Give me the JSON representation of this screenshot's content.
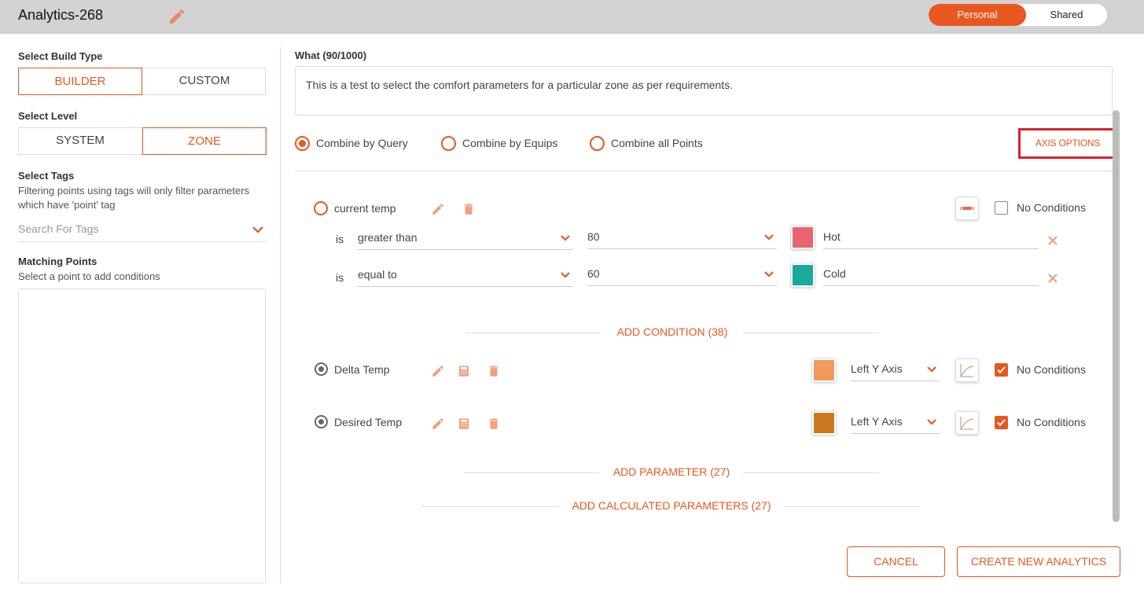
{
  "header": {
    "title": "Analytics-268",
    "toggle": {
      "personal": "Personal",
      "shared": "Shared",
      "selected": "Personal"
    }
  },
  "sidebar": {
    "build_type": {
      "label": "Select Build Type",
      "options": [
        "BUILDER",
        "CUSTOM"
      ],
      "selected": "BUILDER"
    },
    "level": {
      "label": "Select Level",
      "options": [
        "SYSTEM",
        "ZONE"
      ],
      "selected": "ZONE"
    },
    "tags": {
      "label": "Select Tags",
      "help_line1": "Filtering points using tags will only filter parameters",
      "help_line2": "which have 'point' tag",
      "placeholder": "Search For Tags"
    },
    "matching_points": {
      "label": "Matching Points",
      "help": "Select a point to add conditions"
    }
  },
  "main": {
    "what_label": "What (90/1000)",
    "what_text": "This is a test to select the comfort parameters for a particular zone as per requirements.",
    "combine_options": [
      {
        "label": "Combine by Query",
        "selected": true
      },
      {
        "label": "Combine by Equips",
        "selected": false
      },
      {
        "label": "Combine all Points",
        "selected": false
      }
    ],
    "axis_options": "AXIS OPTIONS",
    "params": [
      {
        "name": "current temp",
        "no_conditions_label": "No Conditions",
        "no_conditions_checked": false,
        "conditions": [
          {
            "is": "is",
            "operator": "greater than",
            "value": "80",
            "color": "#e8646f",
            "label": "Hot"
          },
          {
            "is": "is",
            "operator": "equal to",
            "value": "60",
            "color": "#1aaa9b",
            "label": "Cold"
          }
        ]
      },
      {
        "name": "Delta Temp",
        "color": "#f09a5b",
        "axis": "Left Y Axis",
        "no_conditions_label": "No Conditions",
        "no_conditions_checked": true
      },
      {
        "name": "Desired Temp",
        "color": "#c97a1e",
        "axis": "Left Y Axis",
        "no_conditions_label": "No Conditions",
        "no_conditions_checked": true
      }
    ],
    "add_condition": "ADD CONDITION (38)",
    "add_parameter": "ADD PARAMETER (27)",
    "add_calculated": "ADD CALCULATED PARAMETERS (27)"
  },
  "footer": {
    "cancel": "CANCEL",
    "create": "CREATE NEW ANALYTICS"
  },
  "colors": {
    "accent": "#e8571f",
    "highlight_box": "#e01e2a"
  },
  "icons": [
    "pencil-icon",
    "trash-icon",
    "calculator-icon",
    "chevron-down-icon",
    "close-icon",
    "chart-icon",
    "legend-icon"
  ]
}
